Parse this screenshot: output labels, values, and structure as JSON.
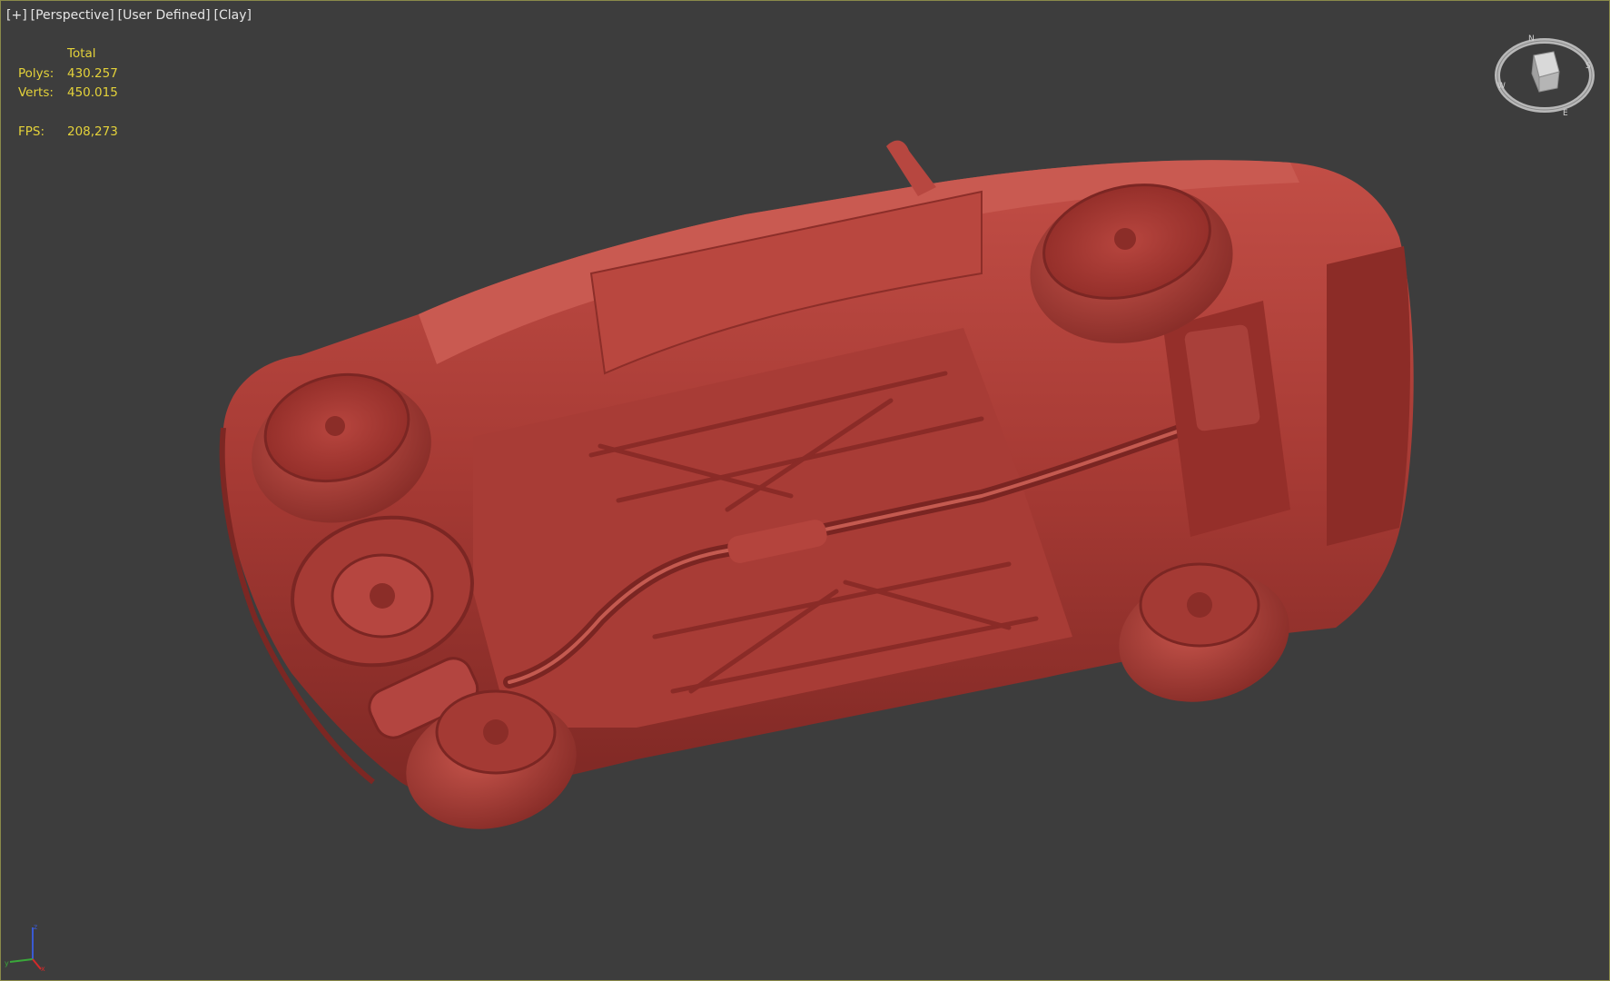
{
  "viewport": {
    "labels": [
      "[+]",
      "[Perspective]",
      "[User Defined]",
      "[Clay]"
    ]
  },
  "stats": {
    "header": "Total",
    "rows": [
      {
        "key": "Polys:",
        "value": "430.257"
      },
      {
        "key": "Verts:",
        "value": "450.015"
      }
    ],
    "fps_label": "FPS:",
    "fps_value": "208,273"
  },
  "scene": {
    "object": "car-underside-model",
    "clay_color": "#b2413a"
  },
  "viewcube": {
    "compass": [
      "N",
      "S",
      "E",
      "W"
    ]
  },
  "axis_gizmo": {
    "x_color": "#d22a2a",
    "y_color": "#3aa83a",
    "z_color": "#3a5ad2"
  }
}
